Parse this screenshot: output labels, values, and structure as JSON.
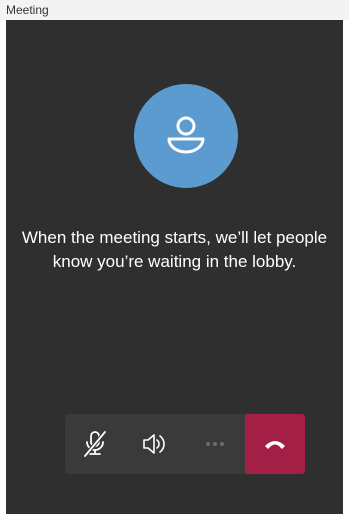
{
  "window": {
    "title": "Meeting"
  },
  "lobby": {
    "message": "When the meeting starts, we’ll let people know you’re waiting in the lobby."
  },
  "call_controls": {
    "items": [
      {
        "icon": "mic-off-icon"
      },
      {
        "icon": "speaker-icon"
      },
      {
        "icon": "more-options-icon"
      },
      {
        "icon": "hang-up-icon"
      }
    ]
  },
  "colors": {
    "background": "#2f2f2f",
    "avatar": "#5b9bd0",
    "callbar": "#3a3a3a",
    "hangup": "#a31f46",
    "text": "#ffffff"
  }
}
